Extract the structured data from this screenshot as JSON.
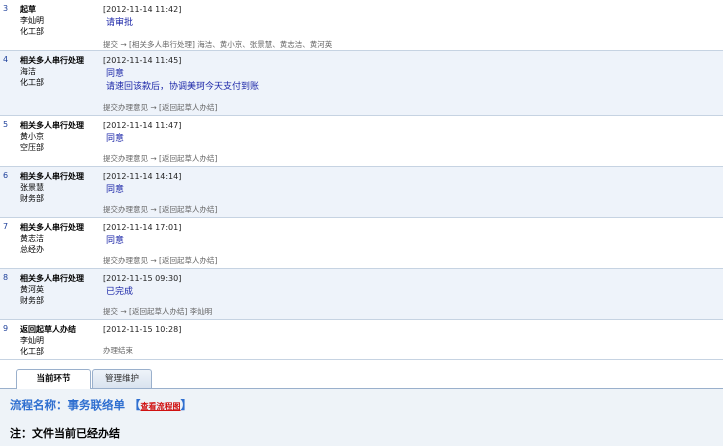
{
  "records": [
    {
      "num": "3",
      "step": "起草",
      "person": "李灿明",
      "dept": "化工部",
      "time": "[2012-11-14 11:42]",
      "opinion": [
        "请审批"
      ],
      "action": "提交 → [相关多人串行处理] 海洁、黄小京、张景慧、黄志洁、黄河英"
    },
    {
      "num": "4",
      "step": "相关多人串行处理",
      "person": "海洁",
      "dept": "化工部",
      "time": "[2012-11-14 11:45]",
      "opinion": [
        "同意",
        "请速回该款后，协调美珂今天支付到账"
      ],
      "action": "提交办理意见 → [返回起草人办结]"
    },
    {
      "num": "5",
      "step": "相关多人串行处理",
      "person": "黄小京",
      "dept": "空压部",
      "time": "[2012-11-14 11:47]",
      "opinion": [
        "同意"
      ],
      "action": "提交办理意见 → [返回起草人办结]"
    },
    {
      "num": "6",
      "step": "相关多人串行处理",
      "person": "张景慧",
      "dept": "财务部",
      "time": "[2012-11-14 14:14]",
      "opinion": [
        "同意"
      ],
      "action": "提交办理意见 → [返回起草人办结]"
    },
    {
      "num": "7",
      "step": "相关多人串行处理",
      "person": "黄志洁",
      "dept": "总经办",
      "time": "[2012-11-14 17:01]",
      "opinion": [
        "同意"
      ],
      "action": "提交办理意见 → [返回起草人办结]"
    },
    {
      "num": "8",
      "step": "相关多人串行处理",
      "person": "黄河英",
      "dept": "财务部",
      "time": "[2012-11-15 09:30]",
      "opinion": [
        "已完成"
      ],
      "action": "提交 → [返回起草人办结] 李灿明"
    },
    {
      "num": "9",
      "step": "返回起草人办结",
      "person": "李灿明",
      "dept": "化工部",
      "time": "[2012-11-15 10:28]",
      "opinion": [],
      "action": "办理结束"
    }
  ],
  "tabs": {
    "current": "当前环节",
    "manage": "管理维护"
  },
  "flow": {
    "title": "流程名称：事务联络单",
    "bracket_open": "【",
    "link": "查看流程图",
    "bracket_close": "】"
  },
  "note": "注：文件当前已经办结"
}
